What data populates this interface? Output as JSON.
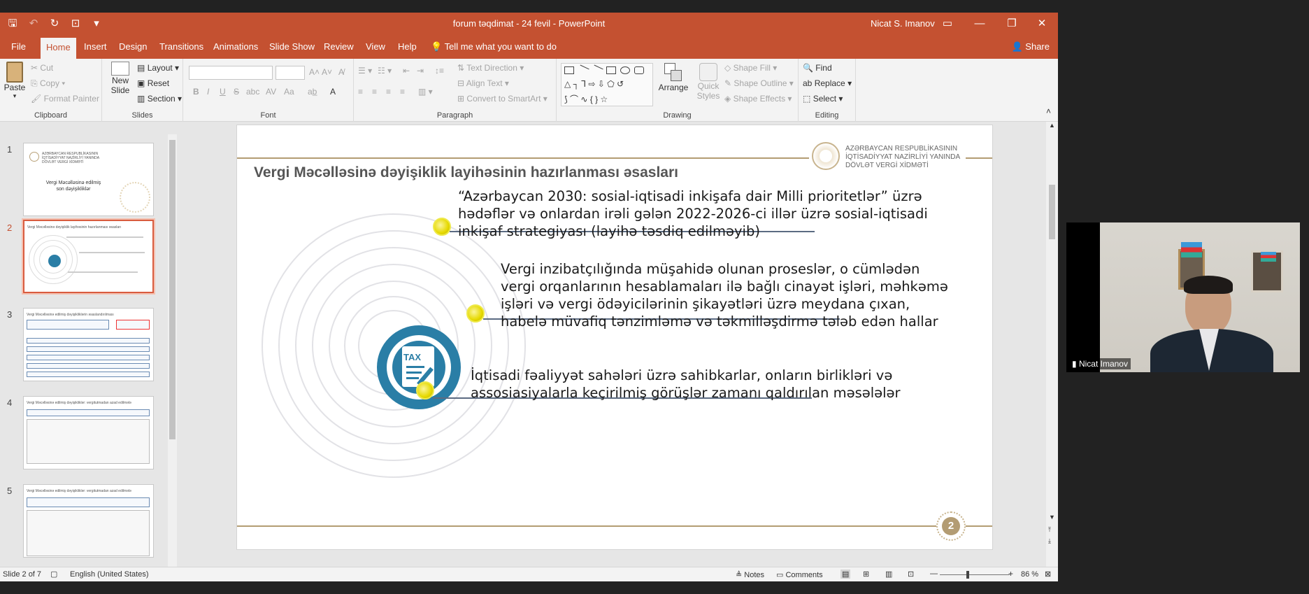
{
  "window": {
    "title": "forum təqdimat - 24 fevil  -  PowerPoint",
    "user": "Nicat S. Imanov"
  },
  "tabs": [
    "File",
    "Home",
    "Insert",
    "Design",
    "Transitions",
    "Animations",
    "Slide Show",
    "Review",
    "View",
    "Help"
  ],
  "tell_me": "Tell me what you want to do",
  "share": "Share",
  "ribbon": {
    "clipboard": {
      "paste": "Paste",
      "cut": "Cut",
      "copy": "Copy",
      "format_painter": "Format Painter",
      "label": "Clipboard"
    },
    "slides": {
      "new_slide": "New Slide",
      "layout": "Layout",
      "reset": "Reset",
      "section": "Section",
      "label": "Slides"
    },
    "font": {
      "label": "Font",
      "bold": "B",
      "italic": "I",
      "underline": "U",
      "strike": "S",
      "shadow": "abc",
      "spacing": "AV",
      "case": "Aa"
    },
    "paragraph": {
      "text_direction": "Text Direction",
      "align_text": "Align Text",
      "convert_smartart": "Convert to SmartArt",
      "label": "Paragraph"
    },
    "drawing": {
      "arrange": "Arrange",
      "quick_styles": "Quick Styles",
      "shape_fill": "Shape Fill",
      "shape_outline": "Shape Outline",
      "shape_effects": "Shape Effects",
      "label": "Drawing"
    },
    "editing": {
      "find": "Find",
      "replace": "Replace",
      "select": "Select",
      "label": "Editing"
    }
  },
  "thumbnails": [
    {
      "num": "1",
      "title": "Vergi Məcəlləsinə edilmiş son dəyişikliklər",
      "logo": "AZƏRBAYCAN RESPUBLİKASININ İQTİSADİYYAT NAZİRLİYİ YANINDA DÖVLƏT VERGİ XİDMƏTİ"
    },
    {
      "num": "2",
      "title": "Vergi Məcəlləsinə dəyişiklik layihəsinin hazırlanması əsasları"
    },
    {
      "num": "3",
      "title": "Vergi Məcəlləsinə edilmiş dəyişikliklərin əsaslandırılması"
    },
    {
      "num": "4",
      "title": "Vergi Məcəlləsinə edilmiş dəyişikliklər: vergitutmadan azad edilmələr"
    },
    {
      "num": "5",
      "title": "Vergi Məcəlləsinə edilmiş dəyişikliklər: vergitutmadan azad edilmələr"
    }
  ],
  "slide": {
    "title": "Vergi Məcəlləsinə dəyişiklik layihəsinin hazırlanması əsasları",
    "logo_text": [
      "AZƏRBAYCAN RESPUBLİKASININ",
      "İQTİSADİYYAT NAZİRLİYİ YANINDA",
      "DÖVLƏT VERGİ XİDMƏTİ"
    ],
    "icon_label": "TAX",
    "page_number": "2",
    "items": [
      {
        "lines": [
          "“Azərbaycan 2030: sosial-iqtisadi inkişafa dair Milli prioritetlər” üzrə",
          "hədəflər və onlardan irəli gələn 2022-2026-ci illər üzrə sosial-iqtisadi",
          "inkişaf strategiyası (layihə təsdiq edilməyib)"
        ]
      },
      {
        "lines": [
          "Vergi inzibatçılığında müşahidə olunan proseslər, o cümlədən",
          "vergi orqanlarının hesablamaları ilə bağlı cinayət işləri, məhkəmə",
          "işləri və vergi ödəyicilərinin şikayətləri üzrə meydana çıxan,",
          "habelə müvafiq tənzimləmə və təkmilləşdirmə tələb edən hallar"
        ]
      },
      {
        "lines": [
          "İqtisadi fəaliyyət sahələri üzrə sahibkarlar, onların birlikləri və",
          "assosiasiyalarla keçirilmiş görüşlər zamanı qaldırılan məsələlər"
        ]
      }
    ]
  },
  "status": {
    "slide_of": "Slide 2 of 7",
    "language": "English (United States)",
    "notes": "Notes",
    "comments": "Comments",
    "zoom": "86 %"
  },
  "video": {
    "name": "Nicat Imanov"
  }
}
